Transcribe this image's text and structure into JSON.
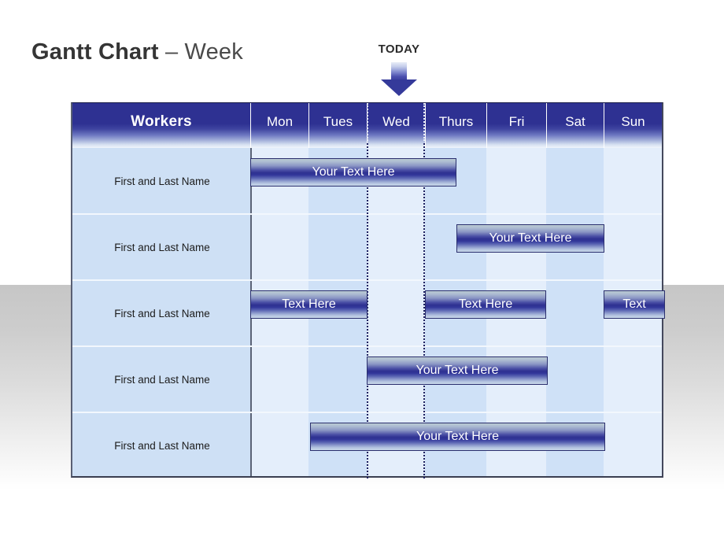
{
  "title": {
    "strong": "Gantt Chart",
    "light": " – Week"
  },
  "today": {
    "label": "TODAY",
    "column": "Wed",
    "arrow_icon": "down-arrow-icon"
  },
  "table": {
    "workers_header": "Workers",
    "day_headers": [
      "Mon",
      "Tues",
      "Wed",
      "Thurs",
      "Fri",
      "Sat",
      "Sun"
    ],
    "rows": [
      {
        "label": "First and Last Name"
      },
      {
        "label": "First and Last Name"
      },
      {
        "label": "First and Last Name"
      },
      {
        "label": "First and Last Name"
      },
      {
        "label": "First and Last Name"
      }
    ]
  },
  "chart_data": {
    "type": "bar",
    "title": "Gantt Chart – Week",
    "xlabel": "",
    "ylabel": "Workers",
    "categories": [
      "Mon",
      "Tues",
      "Wed",
      "Thurs",
      "Fri",
      "Sat",
      "Sun"
    ],
    "today_marker": "Wed",
    "tasks": [
      {
        "row": 0,
        "label": "Your Text Here",
        "start_day": "Mon",
        "end_day": "Thurs",
        "start_index": 0,
        "span": 3.5
      },
      {
        "row": 1,
        "label": "Your Text Here",
        "start_day": "Fri",
        "end_day": "Sat",
        "start_index": 4,
        "span": 2.5
      },
      {
        "row": 2,
        "label": "Text Here",
        "start_day": "Mon",
        "end_day": "Tues",
        "start_index": 0,
        "span": 2
      },
      {
        "row": 2,
        "label": "Text Here",
        "start_day": "Thurs",
        "end_day": "Fri",
        "start_index": 3,
        "span": 2
      },
      {
        "row": 2,
        "label": "Text",
        "start_day": "Sun",
        "end_day": "Sun",
        "start_index": 6,
        "span": 1
      },
      {
        "row": 3,
        "label": "Your Text Here",
        "start_day": "Wed",
        "end_day": "Thurs",
        "start_index": 2,
        "span": 3
      },
      {
        "row": 4,
        "label": "Your Text Here",
        "start_day": "Tues",
        "end_day": "Sat",
        "start_index": 1,
        "span": 5
      }
    ]
  },
  "colors": {
    "accent": "#2e3192",
    "header_dark": "#2e3192",
    "workers_column": "#cee0f5",
    "column_light": "#e4eefb",
    "column_dark": "#cfe1f7",
    "bar_border": "#2b2f6e",
    "background_band": "#c6c6c6",
    "title_text": "#3a3a3a"
  }
}
